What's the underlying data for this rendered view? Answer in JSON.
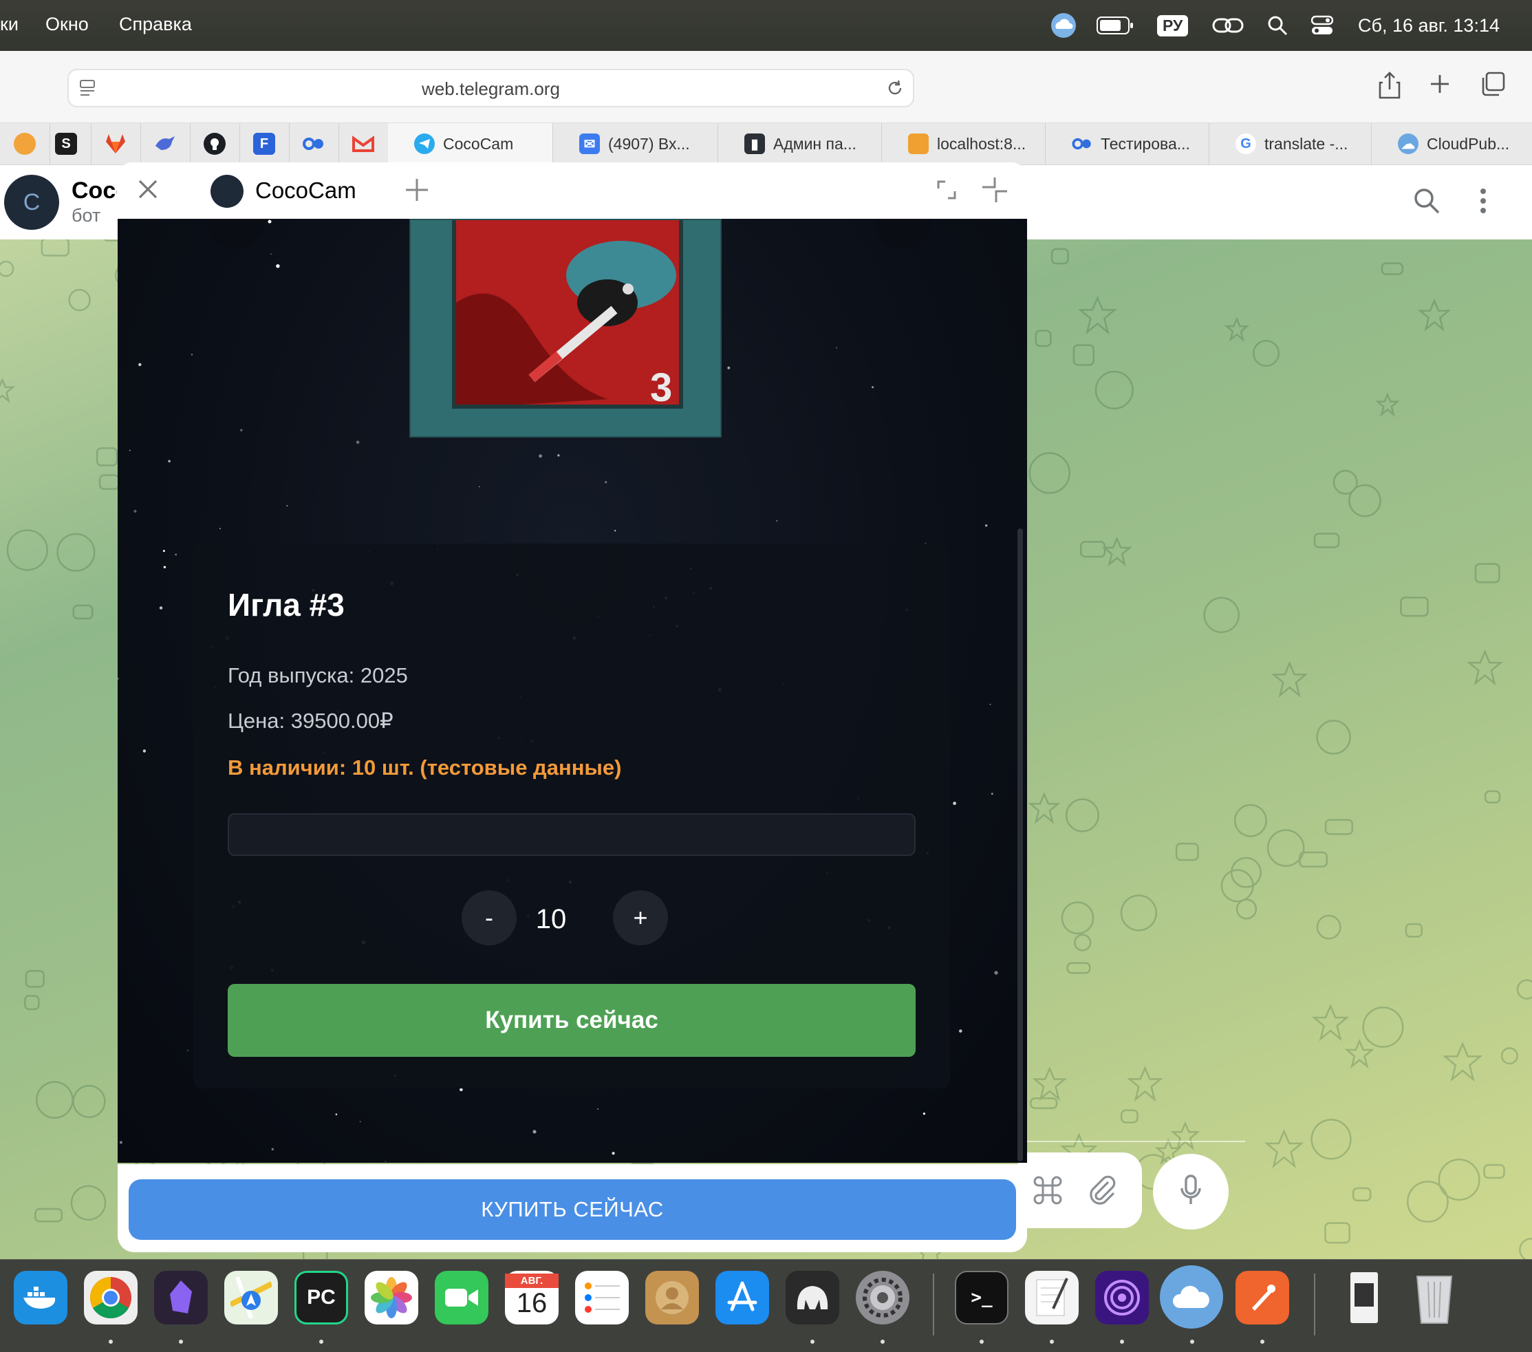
{
  "menubar": {
    "items": [
      "ки",
      "Окно",
      "Справка"
    ],
    "keyboard_layout": "РУ",
    "datetime": "Сб, 16 авг.  13:14"
  },
  "browser": {
    "url": "web.telegram.org",
    "tabs": [
      {
        "label": "CocoCam",
        "icon": "telegram-icon",
        "color": "#2aabee"
      },
      {
        "label": "(4907) Вх...",
        "icon": "mail-icon",
        "color": "#3d7cf0"
      },
      {
        "label": "Админ па...",
        "icon": "terminal-icon",
        "color": "#2b2f36"
      },
      {
        "label": "localhost:8...",
        "icon": "phpmyadmin-icon",
        "color": "#f0a030"
      },
      {
        "label": "Тестирова...",
        "icon": "yougile-icon",
        "color": "#2f6fe0"
      },
      {
        "label": "translate -...",
        "icon": "google-icon",
        "color": "#4285f4"
      },
      {
        "label": "CloudPub...",
        "icon": "cloud-icon",
        "color": "#6aa7e0"
      }
    ]
  },
  "chat": {
    "avatar_initials": "C",
    "title": "Coco",
    "subtitle": "бот"
  },
  "miniapp": {
    "tab_title": "CocoCam",
    "cover_number": "3",
    "product": {
      "title": "Игла #3",
      "year": "Год выпуска: 2025",
      "price": "Цена: 39500.00₽",
      "stock": "В наличии: 10 шт. (тестовые данные)",
      "quantity": "10",
      "minus": "-",
      "plus": "+",
      "buy_label": "Купить сейчас"
    },
    "main_button_label": "КУПИТЬ СЕЙЧАС"
  },
  "dock": {
    "calendar_month": "АВГ.",
    "calendar_day": "16",
    "pycharm_label": "PC"
  },
  "colors": {
    "accent_green": "#4ea154",
    "main_button_blue": "#4a8fe6",
    "stock_orange": "#f39a3a"
  }
}
